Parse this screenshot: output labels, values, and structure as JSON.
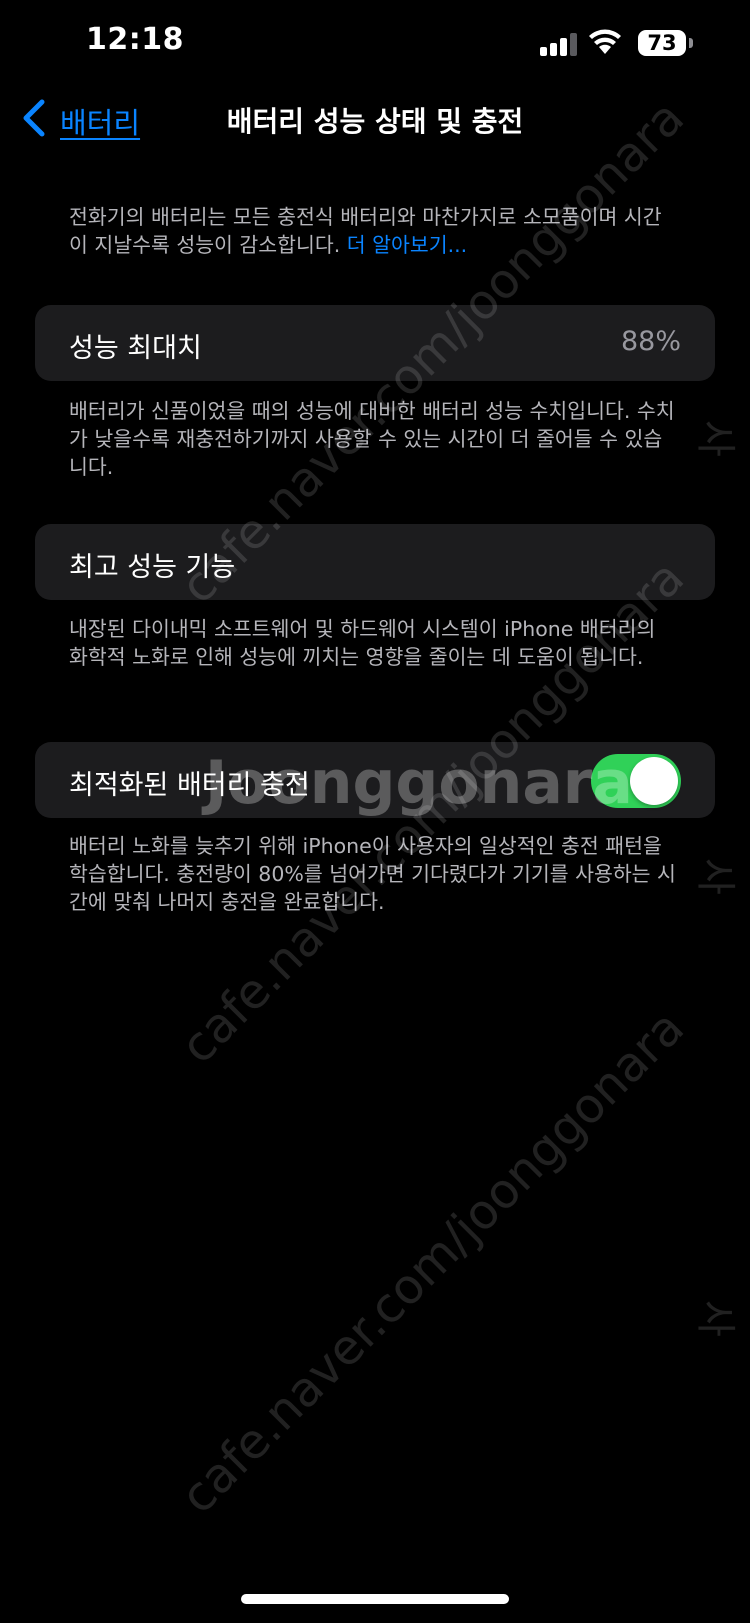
{
  "status_bar": {
    "time": "12:18",
    "battery_level": "73",
    "signal_bars_active": 3,
    "signal_bars_total": 4
  },
  "nav": {
    "back_label": "배터리",
    "title": "배터리 성능 상태 및 충전"
  },
  "intro": {
    "text": "전화기의 배터리는 모든 충전식 배터리와 마찬가지로 소모품이며 시간이 지날수록 성능이 감소합니다. ",
    "link": "더 알아보기..."
  },
  "max_capacity": {
    "label": "성능 최대치",
    "value": "88%",
    "footnote": "배터리가 신품이었을 때의 성능에 대비한 배터리 성능 수치입니다. 수치가 낮을수록 재충전하기까지 사용할 수 있는 시간이 더 줄어들 수 있습니다."
  },
  "peak_performance": {
    "label": "최고 성능 기능",
    "footnote": "내장된 다이내믹 소프트웨어 및 하드웨어 시스템이 iPhone 배터리의 화학적 노화로 인해 성능에 끼치는 영향을 줄이는 데 도움이 됩니다."
  },
  "optimized_charging": {
    "label": "최적화된 배터리 충전",
    "enabled": true,
    "footnote": "배터리 노화를 늦추기 위해 iPhone이 사용자의 일상적인 충전 패턴을 학습합니다. 충전량이 80%를 넘어가면 기다렸다가 기기를 사용하는 시간에 맞춰 나머지 충전을 완료합니다."
  },
  "watermark": {
    "logo": "Joonggonara",
    "url": "cafe.naver.com/joonggonara",
    "side": "사"
  },
  "colors": {
    "background": "#000000",
    "card": "#1c1c1e",
    "accent": "#0a84ff",
    "toggle_on": "#30d158",
    "secondary_text": "#98989f"
  }
}
